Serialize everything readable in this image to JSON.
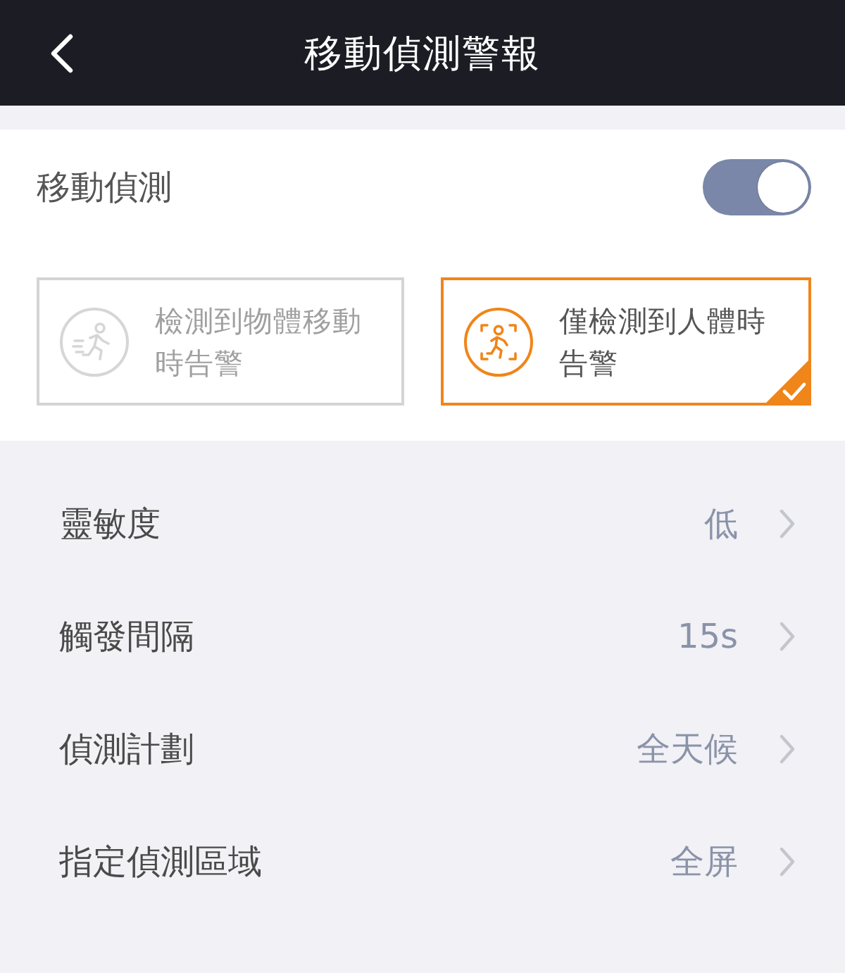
{
  "header": {
    "title": "移動偵測警報"
  },
  "motion_detection": {
    "label": "移動偵測",
    "on": true
  },
  "alert_modes": [
    {
      "kind": "motion",
      "label": "檢測到物體移動時告警",
      "selected": false
    },
    {
      "kind": "human",
      "label": "僅檢測到人體時告警",
      "selected": true
    }
  ],
  "settings": [
    {
      "label": "靈敏度",
      "value": "低"
    },
    {
      "label": "觸發間隔",
      "value": "15s"
    },
    {
      "label": "偵測計劃",
      "value": "全天候"
    },
    {
      "label": "指定偵測區域",
      "value": "全屏"
    }
  ]
}
